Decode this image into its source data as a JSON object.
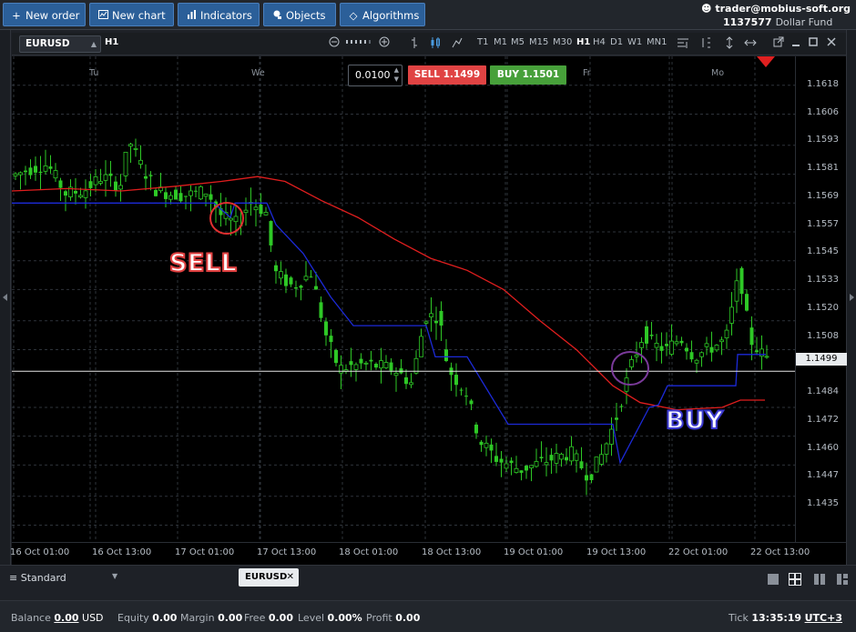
{
  "toolbar": {
    "new_order": "New order",
    "new_chart": "New chart",
    "indicators": "Indicators",
    "objects": "Objects",
    "algorithms": "Algorithms"
  },
  "account": {
    "user": "trader@mobius-soft.org",
    "id": "1137577",
    "fund": "Dollar Fund"
  },
  "chart_window": {
    "symbol": "EURUSD",
    "timeframe": "H1",
    "timeframes": [
      "T1",
      "M1",
      "M5",
      "M15",
      "M30",
      "H1",
      "H4",
      "D1",
      "W1",
      "MN1"
    ],
    "active_timeframe": "H1",
    "lot": "0.0100",
    "sell_label": "SELL",
    "sell_price": "1.1499",
    "buy_label": "BUY",
    "buy_price": "1.1501",
    "day_labels": [
      "Tu",
      "We",
      "Fr",
      "Mo"
    ],
    "price_ticks": [
      "1.1618",
      "1.1606",
      "1.1593",
      "1.1581",
      "1.1569",
      "1.1557",
      "1.1545",
      "1.1533",
      "1.1520",
      "1.1508",
      "1.1484",
      "1.1472",
      "1.1460",
      "1.1447",
      "1.1435"
    ],
    "current_price": "1.1499",
    "time_ticks": [
      "16 Oct 01:00",
      "16 Oct 13:00",
      "17 Oct 01:00",
      "17 Oct 13:00",
      "18 Oct 01:00",
      "18 Oct 13:00",
      "19 Oct 01:00",
      "19 Oct 13:00",
      "22 Oct 01:00",
      "22 Oct 13:00"
    ],
    "annotations": {
      "sell": "SELL",
      "buy": "BUY"
    },
    "colors": {
      "candle": "#2ec826",
      "ma_red": "#e01e1e",
      "line_blue": "#1c2ad8",
      "price_line": "#e6e6e6"
    }
  },
  "bottom": {
    "workspace": "Standard",
    "tab": "EURUSD",
    "balance_label": "Balance",
    "balance_value": "0.00",
    "balance_ccy": "USD",
    "equity_label": "Equity",
    "equity_value": "0.00",
    "margin_label": "Margin",
    "margin_value": "0.00",
    "free_label": "Free",
    "free_value": "0.00",
    "level_label": "Level",
    "level_value": "0.00%",
    "profit_label": "Profit",
    "profit_value": "0.00",
    "tick_label": "Tick",
    "tick_time": "13:35:19",
    "timezone": "UTC+3"
  }
}
